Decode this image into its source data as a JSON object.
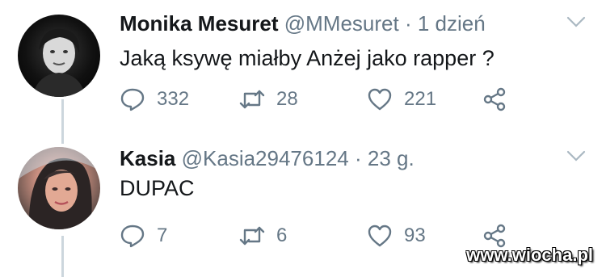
{
  "tweets": [
    {
      "author_name": "Monika Mesuret",
      "handle": "@MMesuret",
      "separator": "·",
      "time": "1 dzień",
      "text": "Jaką ksywę miałby Anżej jako rapper ?",
      "avatar_icon": "avatar-photo",
      "replies": "332",
      "retweets": "28",
      "likes": "221"
    },
    {
      "author_name": "Kasia",
      "handle": "@Kasia29476124",
      "separator": "·",
      "time": "23 g.",
      "text": "DUPAC",
      "avatar_icon": "avatar-photo",
      "replies": "7",
      "retweets": "6",
      "likes": "93"
    }
  ],
  "icons": {
    "reply": "reply-icon",
    "retweet": "retweet-icon",
    "like": "heart-icon",
    "share": "share-icon",
    "menu": "chevron-down-icon"
  },
  "colors": {
    "text": "#14171a",
    "muted": "#657786",
    "thread_line": "#ccd6dd"
  },
  "watermark": "www.wiocha.pl"
}
